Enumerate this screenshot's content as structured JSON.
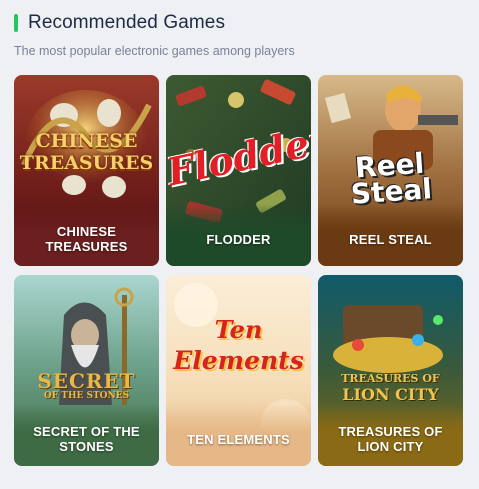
{
  "header": {
    "title": "Recommended Games",
    "subtitle": "The most popular electronic games among players"
  },
  "colors": {
    "accent": "#22c55e",
    "title": "#1f2a44",
    "subtitle": "#7a8299",
    "background": "#eef0f3"
  },
  "games": [
    {
      "label": "CHINESE TREASURES",
      "logo_lines": [
        "CHINESE",
        "TREASURES"
      ],
      "band_color": "#6b1f1f"
    },
    {
      "label": "FLODDER",
      "logo_lines": [
        "Flodder"
      ],
      "band_color": "#1f4a2a"
    },
    {
      "label": "REEL STEAL",
      "logo_lines": [
        "Reel",
        "Steal"
      ],
      "band_color": "#6a3a12"
    },
    {
      "label": "SECRET OF THE STONES",
      "logo_lines": [
        "SECRET",
        "OF THE STONES"
      ],
      "band_color": "#3e6b44"
    },
    {
      "label": "TEN ELEMENTS",
      "logo_lines": [
        "Ten",
        "Elements"
      ],
      "band_color": "#e6b887"
    },
    {
      "label": "TREASURES OF LION CITY",
      "logo_lines": [
        "TREASURES OF",
        "LION CITY"
      ],
      "band_color": "#8a6a14"
    }
  ]
}
